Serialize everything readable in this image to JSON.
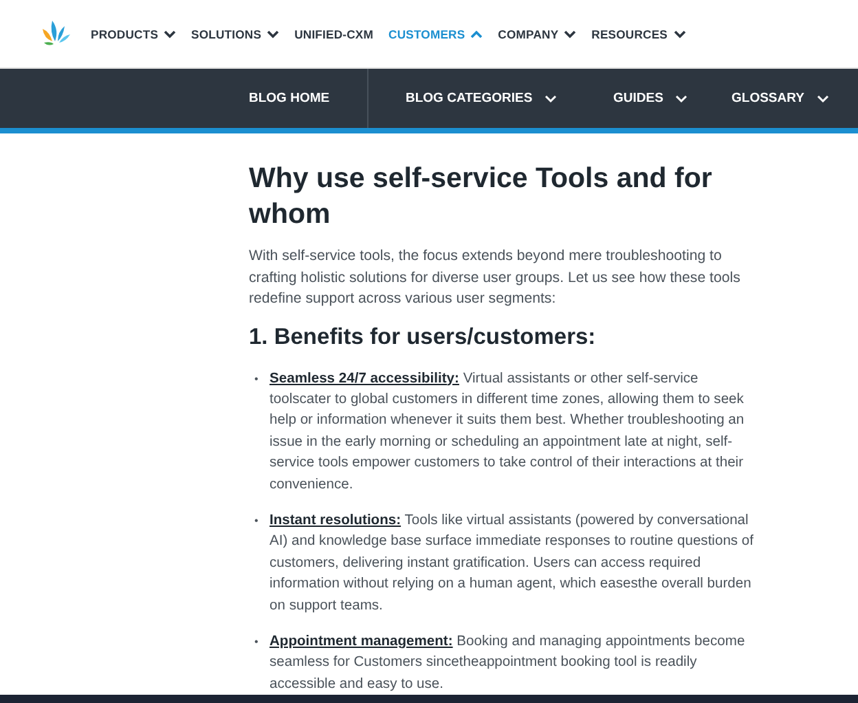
{
  "top_nav": {
    "items": [
      {
        "label": "PRODUCTS",
        "kind": "dropdown",
        "selected": false,
        "expanded": false
      },
      {
        "label": "SOLUTIONS",
        "kind": "dropdown",
        "selected": false,
        "expanded": false
      },
      {
        "label": "UNIFIED-CXM",
        "kind": "link",
        "selected": false
      },
      {
        "label": "CUSTOMERS",
        "kind": "dropdown",
        "selected": true,
        "expanded": true
      },
      {
        "label": "COMPANY",
        "kind": "dropdown",
        "selected": false,
        "expanded": false
      },
      {
        "label": "RESOURCES",
        "kind": "dropdown",
        "selected": false,
        "expanded": false
      }
    ]
  },
  "blog_nav": {
    "items": [
      {
        "label": "BLOG HOME",
        "kind": "link"
      },
      {
        "label": "BLOG CATEGORIES",
        "kind": "dropdown"
      },
      {
        "label": "GUIDES",
        "kind": "dropdown"
      },
      {
        "label": "GLOSSARY",
        "kind": "dropdown"
      }
    ]
  },
  "article": {
    "title": "Why use self-service Tools and for whom",
    "intro": "With self-service tools, the focus extends beyond mere troubleshooting to crafting holistic solutions for diverse user groups. Let us see how these tools redefine support across various user segments:",
    "section_heading": "1. Benefits for users/customers:",
    "bullets": [
      {
        "marker": "•",
        "term": "Seamless 24/7 accessibility:",
        "text": "Virtual assistants or other self-service toolscater to global customers in different time zones, allowing them to seek help or information whenever it suits them best. Whether troubleshooting an issue in the early morning or scheduling an appointment late at night, self-service tools empower customers to take control of their interactions at their convenience."
      },
      {
        "marker": "•",
        "term": "Instant resolutions:",
        "text": "Tools like virtual assistants (powered by conversational AI) and knowledge base surface immediate responses to routine questions of customers, delivering instant gratification. Users can access required information without relying on a human agent, which easesthe overall burden on support teams."
      },
      {
        "marker": "•",
        "term": "Appointment management:",
        "text": "Booking and managing appointments become seamless for Customers sincetheappointment booking tool is readily accessible and easy to use."
      }
    ]
  }
}
